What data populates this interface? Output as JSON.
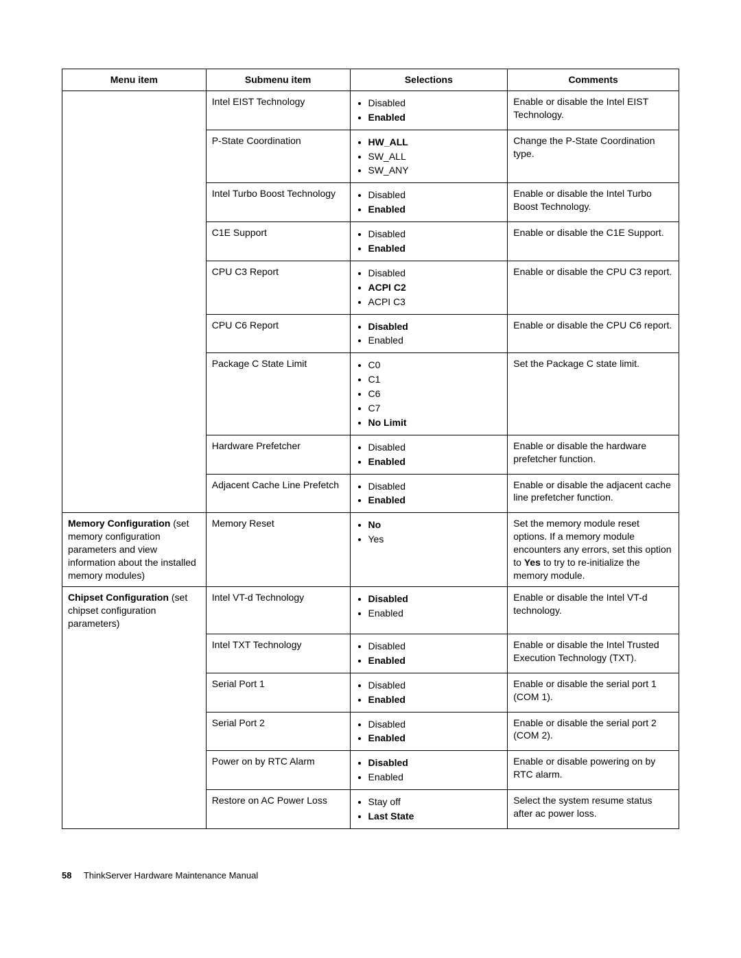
{
  "headers": {
    "c1": "Menu item",
    "c2": "Submenu item",
    "c3": "Selections",
    "c4": "Comments"
  },
  "rows": [
    {
      "menuGroupStart": true,
      "menuGroupEnd": false,
      "menuTitle": "",
      "menuDesc": "",
      "submenu": "Intel EIST Technology",
      "selections": [
        {
          "text": "Disabled",
          "bold": false
        },
        {
          "text": "Enabled",
          "bold": true
        }
      ],
      "comments": [
        {
          "text": "Enable or disable the Intel EIST Technology."
        }
      ]
    },
    {
      "menuGroupStart": false,
      "menuGroupEnd": false,
      "submenu": "P-State Coordination",
      "selections": [
        {
          "text": "HW_ALL",
          "bold": true
        },
        {
          "text": "SW_ALL",
          "bold": false
        },
        {
          "text": "SW_ANY",
          "bold": false
        }
      ],
      "comments": [
        {
          "text": "Change the P-State Coordination type."
        }
      ]
    },
    {
      "menuGroupStart": false,
      "menuGroupEnd": false,
      "submenu": "Intel Turbo Boost Technology",
      "selections": [
        {
          "text": "Disabled",
          "bold": false
        },
        {
          "text": "Enabled",
          "bold": true
        }
      ],
      "comments": [
        {
          "text": "Enable or disable the Intel Turbo Boost Technology."
        }
      ]
    },
    {
      "menuGroupStart": false,
      "menuGroupEnd": false,
      "submenu": "C1E Support",
      "selections": [
        {
          "text": "Disabled",
          "bold": false
        },
        {
          "text": "Enabled",
          "bold": true
        }
      ],
      "comments": [
        {
          "text": "Enable or disable the C1E Support."
        }
      ]
    },
    {
      "menuGroupStart": false,
      "menuGroupEnd": false,
      "submenu": "CPU C3 Report",
      "selections": [
        {
          "text": "Disabled",
          "bold": false
        },
        {
          "text": "ACPI C2",
          "bold": true
        },
        {
          "text": "ACPI C3",
          "bold": false
        }
      ],
      "comments": [
        {
          "text": "Enable or disable the CPU C3 report."
        }
      ]
    },
    {
      "menuGroupStart": false,
      "menuGroupEnd": false,
      "submenu": "CPU C6 Report",
      "selections": [
        {
          "text": "Disabled",
          "bold": true
        },
        {
          "text": "Enabled",
          "bold": false
        }
      ],
      "comments": [
        {
          "text": "Enable or disable the CPU C6 report."
        }
      ]
    },
    {
      "menuGroupStart": false,
      "menuGroupEnd": false,
      "submenu": "Package C State Limit",
      "selections": [
        {
          "text": "C0",
          "bold": false
        },
        {
          "text": "C1",
          "bold": false
        },
        {
          "text": "C6",
          "bold": false
        },
        {
          "text": "C7",
          "bold": false
        },
        {
          "text": "No Limit",
          "bold": true
        }
      ],
      "comments": [
        {
          "text": "Set the Package C state limit."
        }
      ]
    },
    {
      "menuGroupStart": false,
      "menuGroupEnd": false,
      "submenu": "Hardware Prefetcher",
      "selections": [
        {
          "text": "Disabled",
          "bold": false
        },
        {
          "text": "Enabled",
          "bold": true
        }
      ],
      "comments": [
        {
          "text": "Enable or disable the hardware prefetcher function."
        }
      ]
    },
    {
      "menuGroupStart": false,
      "menuGroupEnd": true,
      "submenu": "Adjacent Cache Line Prefetch",
      "selections": [
        {
          "text": "Disabled",
          "bold": false
        },
        {
          "text": "Enabled",
          "bold": true
        }
      ],
      "comments": [
        {
          "text": "Enable or disable the adjacent cache line prefetcher function."
        }
      ]
    },
    {
      "menuGroupStart": true,
      "menuGroupEnd": true,
      "menuTitle": "Memory Configuration",
      "menuDesc": "(set memory configuration parameters and view information about the installed memory modules)",
      "submenu": "Memory Reset",
      "selections": [
        {
          "text": "No",
          "bold": true
        },
        {
          "text": "Yes",
          "bold": false
        }
      ],
      "comments": [
        {
          "pre": "Set the memory module reset options. If a memory module encounters any errors, set this option to ",
          "boldWord": "Yes",
          "post": " to try to re-initialize the memory module."
        }
      ]
    },
    {
      "menuGroupStart": true,
      "menuGroupEnd": false,
      "menuTitle": "Chipset Configuration",
      "menuDesc": "(set chipset configuration parameters)",
      "submenu": "Intel VT-d Technology",
      "selections": [
        {
          "text": "Disabled",
          "bold": true
        },
        {
          "text": "Enabled",
          "bold": false
        }
      ],
      "comments": [
        {
          "text": "Enable or disable the Intel VT-d technology."
        }
      ]
    },
    {
      "menuGroupStart": false,
      "menuGroupEnd": false,
      "submenu": "Intel TXT Technology",
      "selections": [
        {
          "text": "Disabled",
          "bold": false
        },
        {
          "text": "Enabled",
          "bold": true
        }
      ],
      "comments": [
        {
          "text": "Enable or disable the Intel Trusted Execution Technology (TXT)."
        }
      ]
    },
    {
      "menuGroupStart": false,
      "menuGroupEnd": false,
      "submenu": "Serial Port 1",
      "selections": [
        {
          "text": "Disabled",
          "bold": false
        },
        {
          "text": "Enabled",
          "bold": true
        }
      ],
      "comments": [
        {
          "text": "Enable or disable the serial port 1 (COM 1)."
        }
      ]
    },
    {
      "menuGroupStart": false,
      "menuGroupEnd": false,
      "submenu": "Serial Port 2",
      "selections": [
        {
          "text": "Disabled",
          "bold": false
        },
        {
          "text": "Enabled",
          "bold": true
        }
      ],
      "comments": [
        {
          "text": "Enable or disable the serial port 2 (COM 2)."
        }
      ]
    },
    {
      "menuGroupStart": false,
      "menuGroupEnd": false,
      "submenu": "Power on by RTC Alarm",
      "selections": [
        {
          "text": "Disabled",
          "bold": true
        },
        {
          "text": "Enabled",
          "bold": false
        }
      ],
      "comments": [
        {
          "text": "Enable or disable powering on by RTC alarm."
        }
      ]
    },
    {
      "menuGroupStart": false,
      "menuGroupEnd": true,
      "submenu": "Restore on AC Power Loss",
      "selections": [
        {
          "text": "Stay off",
          "bold": false
        },
        {
          "text": "Last State",
          "bold": true
        }
      ],
      "comments": [
        {
          "text": "Select the system resume status after ac power loss."
        }
      ]
    }
  ],
  "footer": {
    "pageNumber": "58",
    "docTitle": "ThinkServer Hardware Maintenance Manual"
  }
}
